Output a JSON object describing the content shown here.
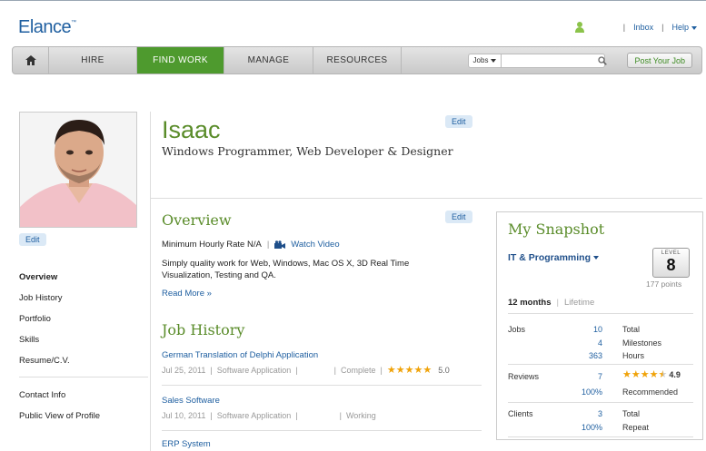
{
  "brand": {
    "logo": "Elance",
    "trademark": "™"
  },
  "toplinks": {
    "inbox": "Inbox",
    "help": "Help",
    "sep": "|"
  },
  "nav": {
    "items": [
      "HIRE",
      "FIND WORK",
      "MANAGE",
      "RESOURCES"
    ],
    "active": "FIND WORK",
    "search_scope": "Jobs",
    "search_placeholder": "",
    "post_job": "Post Your Job"
  },
  "profile": {
    "name": "Isaac",
    "headline": "Windows Programmer, Web Developer & Designer",
    "edit_label": "Edit",
    "sidenav": [
      "Overview",
      "Job History",
      "Portfolio",
      "Skills",
      "Resume/C.V."
    ],
    "sidenav2": [
      "Contact Info",
      "Public View of Profile"
    ]
  },
  "overview": {
    "title": "Overview",
    "rate": "Minimum Hourly Rate N/A",
    "sep": "|",
    "video": "Watch Video",
    "text": "Simply quality work for Web, Windows, Mac OS X, 3D Real Time Visualization, Testing and QA.",
    "read_more": "Read More »"
  },
  "job_history": {
    "title": "Job History",
    "jobs": [
      {
        "title": "German Translation of Delphi Application",
        "date": "Jul 25, 2011",
        "category": "Software Application",
        "status": "Complete",
        "rating": "5.0",
        "stars": 5
      },
      {
        "title": "Sales Software",
        "date": "Jul 10, 2011",
        "category": "Software Application",
        "status": "Working"
      },
      {
        "title": "ERP System"
      }
    ]
  },
  "snapshot": {
    "title": "My Snapshot",
    "category": "IT & Programming",
    "level_label": "LEVEL",
    "level": "8",
    "points": "177 points",
    "period_active": "12 months",
    "period_other": "Lifetime",
    "jobs": {
      "label": "Jobs",
      "rows": [
        [
          "10",
          "Total"
        ],
        [
          "4",
          "Milestones"
        ],
        [
          "363",
          "Hours"
        ]
      ]
    },
    "reviews": {
      "label": "Reviews",
      "count": "7",
      "rating": "4.9",
      "stars": 4.5,
      "pct": "100%",
      "pct_label": "Recommended"
    },
    "clients": {
      "label": "Clients",
      "rows": [
        [
          "3",
          "Total"
        ],
        [
          "100%",
          "Repeat"
        ]
      ]
    }
  },
  "colors": {
    "brand_blue": "#1f5fa0",
    "green": "#5a8c2a",
    "nav_active": "#4e9a2e",
    "star": "#f0a30a"
  }
}
